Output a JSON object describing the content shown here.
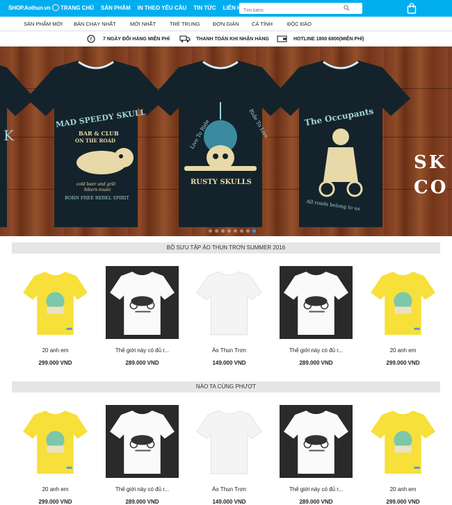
{
  "header": {
    "logo": "SHOP.Aothun.vn",
    "nav": [
      "TRANG CHỦ",
      "SẢN PHẨM",
      "IN THEO YÊU CẦU",
      "TIN TỨC",
      "LIÊN HỆ"
    ],
    "search_placeholder": "Tìm kiếm"
  },
  "categories": [
    "SẢN PHẨM MỚI",
    "BÁN CHẠY NHẤT",
    "MỚI NHẤT",
    "TRẺ TRUNG",
    "ĐƠN GIẢN",
    "CÁ TÍNH",
    "ĐỘC ĐÁO"
  ],
  "benefits": [
    "7 NGÀY ĐỔI HÀNG MIỄN PHÍ",
    "THANH TOÁN KHI NHẬN HÀNG",
    "HOTLINE 1800 6800(MIỄN PHÍ)"
  ],
  "banner": {
    "text_line1": "SK",
    "text_line2": "CO",
    "shirt1": {
      "line1": "MAD SPEEDY SKULL",
      "line2": "BAR & CLUB",
      "line3": "ON THE ROAD",
      "line4": "cold beer and grill",
      "line5": "bikers music",
      "line6": "BORN FREE REBEL SPIRIT"
    },
    "shirt2": {
      "line1": "Live To Ride",
      "line2": "Ride To Live",
      "line3": "RUSTY SKULLS"
    },
    "shirt3": {
      "line1": "The Occupants",
      "line2": "All roads belong to us"
    },
    "active_slide": 7,
    "slide_count": 8
  },
  "sections": [
    {
      "title": "BỘ SƯU TẬP ÁO THUN TRƠN SUMMER 2016",
      "products": [
        {
          "name": "20 anh em",
          "price": "299.000 VND",
          "style": "yellow"
        },
        {
          "name": "Thế giới này có đủ r...",
          "price": "289.000 VND",
          "style": "dark"
        },
        {
          "name": "Áo Thun Trơn",
          "price": "149.000 VND",
          "style": "plain"
        },
        {
          "name": "Thế giới này có đủ r...",
          "price": "289.000 VND",
          "style": "dark"
        },
        {
          "name": "20 anh em",
          "price": "299.000 VND",
          "style": "yellow"
        }
      ]
    },
    {
      "title": "NÀO TA CÙNG PHƯỢT",
      "products": [
        {
          "name": "20 anh em",
          "price": "299.000 VND",
          "style": "yellow"
        },
        {
          "name": "Thế giới này có đủ r...",
          "price": "289.000 VND",
          "style": "dark"
        },
        {
          "name": "Áo Thun Trơn",
          "price": "149.000 VND",
          "style": "plain"
        },
        {
          "name": "Thế giới này có đủ r...",
          "price": "289.000 VND",
          "style": "dark"
        },
        {
          "name": "20 anh em",
          "price": "299.000 VND",
          "style": "yellow"
        }
      ]
    }
  ],
  "colors": {
    "accent": "#00aeef",
    "section_bg": "#e5e5e5",
    "shirt_yellow": "#f7e03a",
    "shirt_dark_bg": "#2a2a2a"
  }
}
